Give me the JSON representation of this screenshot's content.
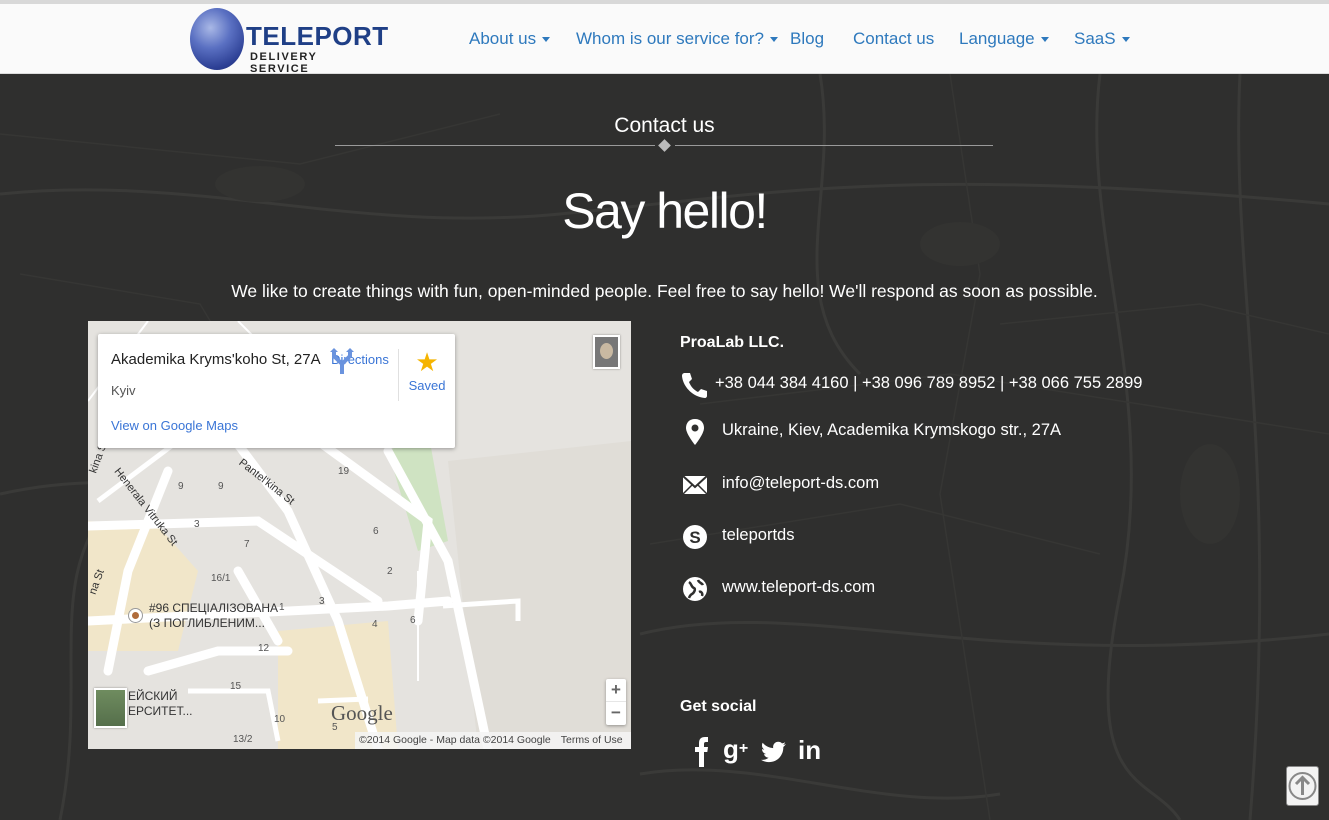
{
  "logo": {
    "title": "TELEPORT",
    "subtitle": "DELIVERY SERVICE"
  },
  "nav": {
    "items": [
      {
        "label": "About us",
        "dropdown": true
      },
      {
        "label": "Whom is our service for?",
        "dropdown": true
      },
      {
        "label": "Blog",
        "dropdown": false
      },
      {
        "label": "Contact us",
        "dropdown": false
      },
      {
        "label": "Language",
        "dropdown": true
      },
      {
        "label": "SaaS",
        "dropdown": true
      }
    ]
  },
  "section": {
    "title": "Contact us",
    "headline": "Say hello!",
    "intro": "We like to create things with fun, open-minded people. Feel free to say hello! We'll respond as soon as possible."
  },
  "map": {
    "place_title": "Akademika Kryms'koho St, 27A",
    "place_city": "Kyiv",
    "view_link": "View on Google Maps",
    "directions_label": "Directions",
    "saved_label": "Saved",
    "poi_line1": "#96 СПЕЦІАЛІЗОВАНА",
    "poi_line2": "(З ПОГЛИБЛЕНИМ...",
    "corner_line1": "ЕЙСКИЙ",
    "corner_line2": "ЕРСИТЕТ...",
    "streets": [
      "Pantel'kina St",
      "Henerala Vitruka St",
      "kina St",
      "na St",
      "Vitruka"
    ],
    "house_numbers": [
      "19",
      "6",
      "9",
      "3",
      "9",
      "7",
      "16/1",
      "2",
      "1",
      "3",
      "4",
      "6",
      "12",
      "15",
      "10",
      "13/2",
      "5"
    ],
    "google_logo": "Google",
    "attribution": "©2014 Google - Map data ©2014 Google",
    "terms": "Terms of Use",
    "zoom_in": "+",
    "zoom_out": "−"
  },
  "contact": {
    "company": "ProaLab LLC.",
    "phone": "+38 044 384 4160 | +38 096 789 8952 | +38 066 755 2899",
    "address": "Ukraine, Kiev, Academika Krymskogo str., 27A",
    "email": "info@teleport-ds.com",
    "skype": "teleportds",
    "website": "www.teleport-ds.com"
  },
  "social": {
    "title": "Get social",
    "networks": [
      "facebook-icon",
      "google-plus-icon",
      "twitter-icon",
      "linkedin-icon"
    ]
  },
  "colors": {
    "nav_link": "#2e79bd",
    "logo_blue": "#1f3f86",
    "background_dark": "#2f2f2e",
    "map_link": "#3a75d6"
  }
}
